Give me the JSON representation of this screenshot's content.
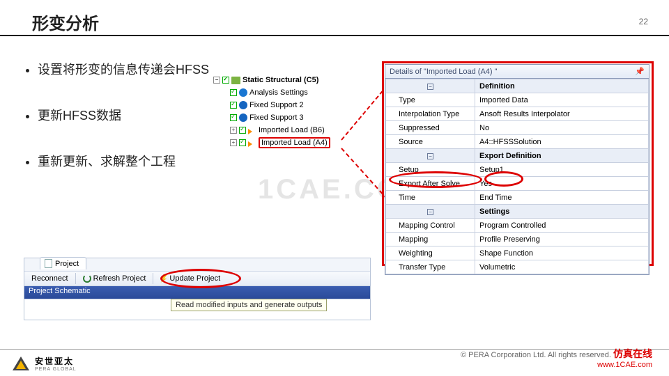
{
  "page": {
    "title": "形变分析",
    "number": "22"
  },
  "bullets": [
    "设置将形变的信息传递会HFSS",
    "更新HFSS数据",
    "重新更新、求解整个工程"
  ],
  "tree": {
    "root": "Static Structural (C5)",
    "items": [
      "Analysis Settings",
      "Fixed Support 2",
      "Fixed Support 3",
      "Imported Load (B6)",
      "Imported Load (A4)"
    ]
  },
  "details": {
    "title": "Details of \"Imported Load (A4) \"",
    "sections": [
      {
        "name": "Definition",
        "rows": [
          {
            "k": "Type",
            "v": "Imported Data"
          },
          {
            "k": "Interpolation Type",
            "v": "Ansoft Results Interpolator"
          },
          {
            "k": "Suppressed",
            "v": "No"
          },
          {
            "k": "Source",
            "v": "A4::HFSSSolution"
          }
        ]
      },
      {
        "name": "Export Definition",
        "rows": [
          {
            "k": "Setup",
            "v": "Setup1"
          },
          {
            "k": "Export After Solve",
            "v": "Yes"
          },
          {
            "k": "Time",
            "v": "End Time"
          }
        ]
      },
      {
        "name": "Settings",
        "rows": [
          {
            "k": "Mapping Control",
            "v": "Program Controlled"
          },
          {
            "k": "Mapping",
            "v": "Profile Preserving"
          },
          {
            "k": "Weighting",
            "v": "Shape Function"
          },
          {
            "k": "Transfer Type",
            "v": "Volumetric"
          }
        ]
      }
    ]
  },
  "project": {
    "tab": "Project",
    "reconnect": "Reconnect",
    "refresh": "Refresh Project",
    "update": "Update Project",
    "schematic": "Project Schematic",
    "tooltip": "Read modified inputs and generate outputs"
  },
  "footer": {
    "logo_cn": "安世亚太",
    "logo_en": "PERA GLOBAL",
    "copyright": "©   PERA Corporation Ltd. All rights reserved.",
    "brand": "仿真在线",
    "url": "www.1CAE.com"
  },
  "watermark": "1CAE.COM"
}
